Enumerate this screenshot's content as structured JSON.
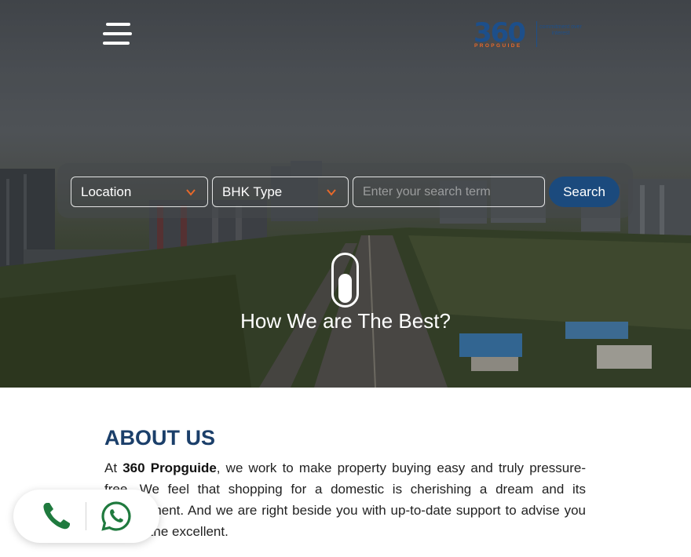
{
  "header": {
    "menu_icon": "hamburger-menu-icon",
    "logo": {
      "number": "360",
      "name": "PROPGUIDE",
      "tagline": "commitment over interest"
    }
  },
  "search": {
    "location_label": "Location",
    "bhk_label": "BHK Type",
    "input_placeholder": "Enter your search term",
    "input_value": "",
    "button_label": "Search",
    "accent_color": "#e8692a",
    "button_color": "#1b4a7d"
  },
  "hero": {
    "scroll_icon": "scroll-mouse-icon",
    "title": "How We are The Best?"
  },
  "about": {
    "title": "ABOUT US",
    "intro": "At ",
    "brand": "360 Propguide",
    "body": ", we work to make property buying easy and truly pressure-free. We feel that shopping for a domestic is cherishing a dream and its achievement. And we are right beside you with up-to-date support to advise you to reap the excellent."
  },
  "contact": {
    "phone_icon": "phone-icon",
    "whatsapp_icon": "whatsapp-icon",
    "icon_color": "#1f7a3e"
  }
}
